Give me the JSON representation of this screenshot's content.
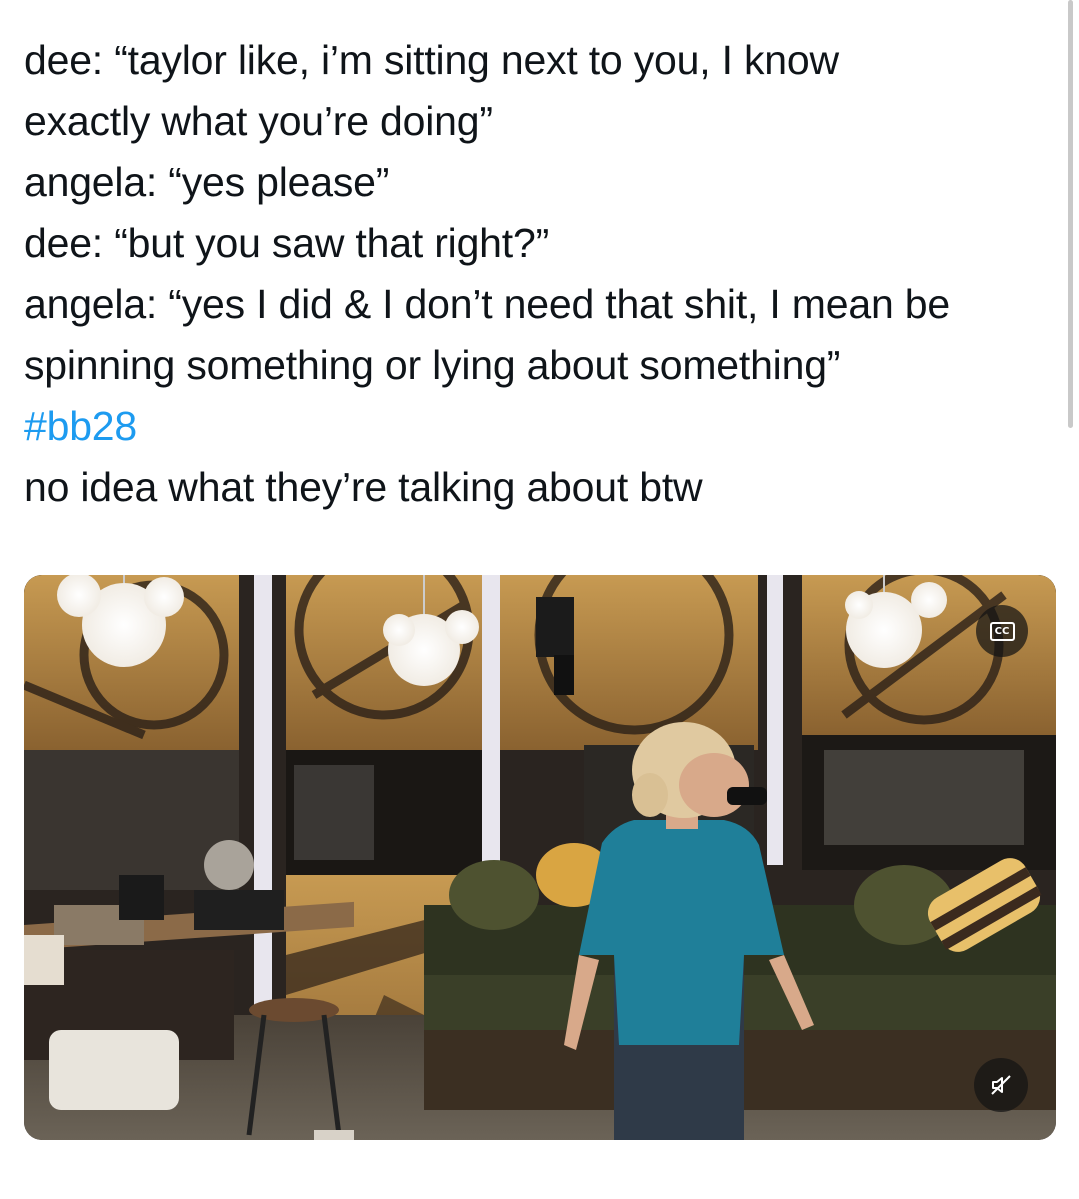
{
  "tweet": {
    "lines": [
      "dee: “taylor like, i’m sitting next to you, I know",
      "exactly what you’re doing”",
      "angela: “yes please”",
      "dee: “but you saw that right?”",
      "angela: “yes I did & I don’t need that shit, I mean be",
      "spinning something or lying about something”"
    ],
    "hashtag": "#bb28",
    "comment": "no idea what they’re talking about btw"
  },
  "video": {
    "cc_label": "CC",
    "cc_icon": "closed-captions-icon",
    "mute_icon": "muted-speaker-icon"
  },
  "colors": {
    "hashtag": "#1d9bf0",
    "text": "#0f1419",
    "control_bg": "#141414"
  }
}
